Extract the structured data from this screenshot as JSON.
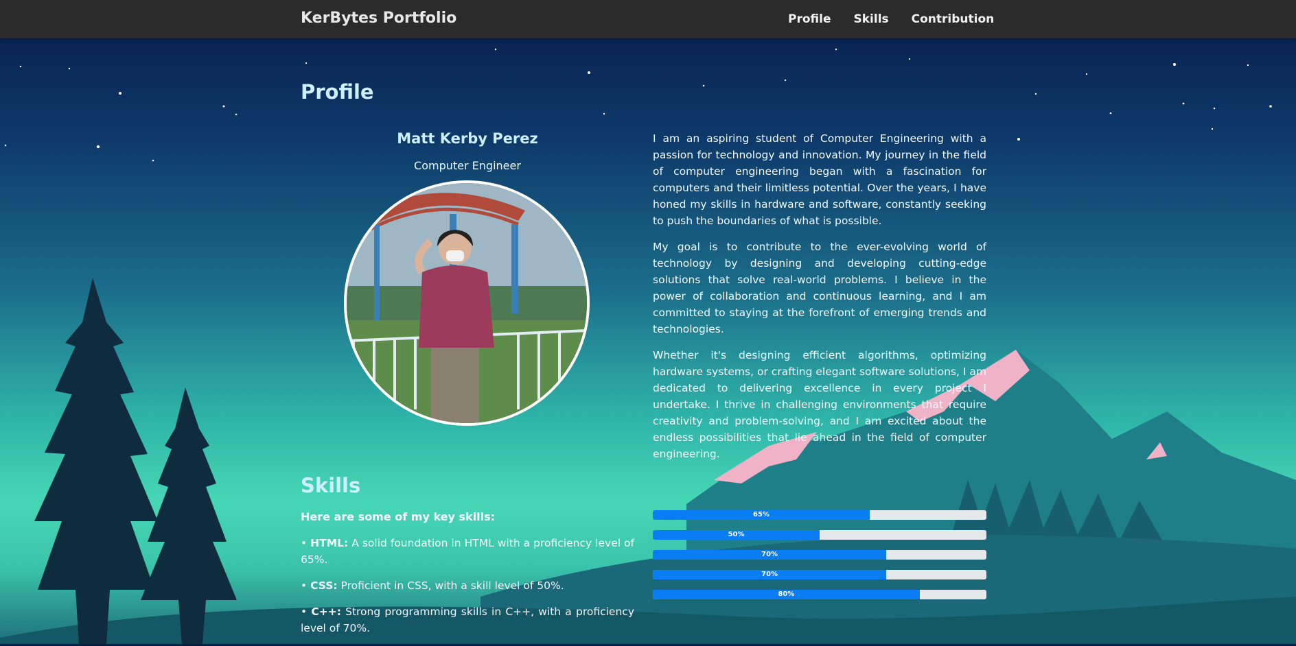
{
  "navbar": {
    "brand": "KerBytes Portfolio",
    "links": [
      "Profile",
      "Skills",
      "Contribution"
    ]
  },
  "profile": {
    "title": "Profile",
    "name": "Matt Kerby Perez",
    "job": "Computer Engineer",
    "bio": [
      "I am an aspiring student of Computer Engineering with a passion for technology and innovation. My journey in the field of computer engineering began with a fascination for computers and their limitless potential. Over the years, I have honed my skills in hardware and software, constantly seeking to push the boundaries of what is possible.",
      "My goal is to contribute to the ever-evolving world of technology by designing and developing cutting-edge solutions that solve real-world problems. I believe in the power of collaboration and continuous learning, and I am committed to staying at the forefront of emerging trends and technologies.",
      "Whether it's designing efficient algorithms, optimizing hardware systems, or crafting elegant software solutions, I am dedicated to delivering excellence in every project I undertake. I thrive in challenging environments that require creativity and problem-solving, and I am excited about the endless possibilities that lie ahead in the field of computer engineering."
    ]
  },
  "skills": {
    "title": "Skills",
    "intro": "Here are some of my key skills:",
    "items": [
      {
        "bullet": "•",
        "name": "HTML:",
        "desc": " A solid foundation in HTML with a proficiency level of 65%."
      },
      {
        "bullet": "•",
        "name": "CSS:",
        "desc": " Proficient in CSS, with a skill level of 50%."
      },
      {
        "bullet": "•",
        "name": "C++:",
        "desc": " Strong programming skills in C++, with a proficiency level of 70%."
      }
    ],
    "bars": [
      {
        "label": "65%",
        "value": 65
      },
      {
        "label": "50%",
        "value": 50
      },
      {
        "label": "70%",
        "value": 70
      },
      {
        "label": "70%",
        "value": 70
      },
      {
        "label": "80%",
        "value": 80
      }
    ]
  },
  "colors": {
    "navbar": "#2b2b2b",
    "bar_fill": "#0a7df5",
    "bar_track": "#e6e9ec",
    "heading": "#cdefff"
  }
}
